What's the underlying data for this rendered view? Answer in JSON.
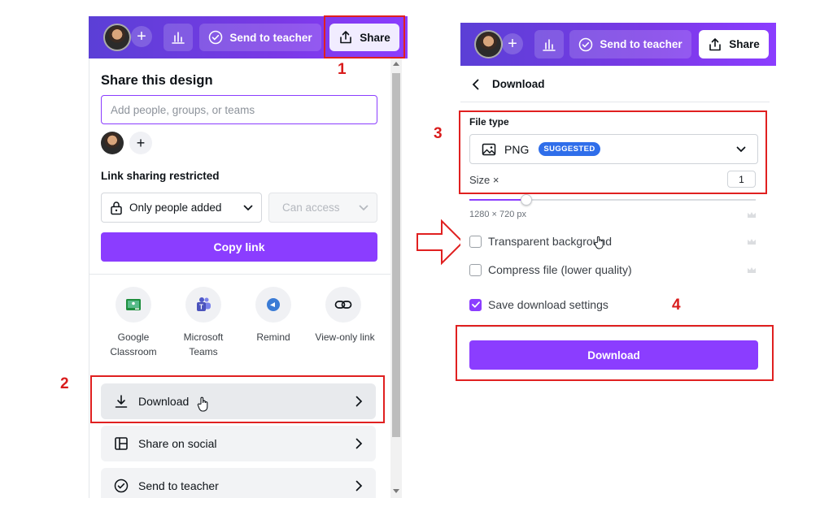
{
  "left": {
    "topbar": {
      "avatar_plus": "+",
      "send_to_teacher": "Send to teacher",
      "share": "Share"
    },
    "title": "Share this design",
    "people_input_placeholder": "Add people, groups, or teams",
    "add_plus": "+",
    "link_sharing_label": "Link sharing restricted",
    "access_select": "Only people added",
    "permission_select": "Can access",
    "copy_link": "Copy link",
    "apps": [
      {
        "label_line1": "Google",
        "label_line2": "Classroom",
        "icon": "google-classroom-icon",
        "color": "#1e8e3e"
      },
      {
        "label_line1": "Microsoft",
        "label_line2": "Teams",
        "icon": "microsoft-teams-icon",
        "color": "#5059c9"
      },
      {
        "label_line1": "Remind",
        "label_line2": "",
        "icon": "remind-icon",
        "color": "#3a7bd5"
      },
      {
        "label_line1": "View-only link",
        "label_line2": "",
        "icon": "link-icon",
        "color": "#0e1318"
      }
    ],
    "rows": [
      {
        "label": "Download",
        "icon": "download-icon"
      },
      {
        "label": "Share on social",
        "icon": "social-layout-icon"
      },
      {
        "label": "Send to teacher",
        "icon": "check-circle-icon"
      }
    ]
  },
  "right": {
    "topbar": {
      "avatar_plus": "+",
      "send_to_teacher": "Send to teacher",
      "share": "Share"
    },
    "back_title": "Download",
    "file_type_label": "File type",
    "file_type_value": "PNG",
    "suggested_badge": "SUGGESTED",
    "size_label": "Size ×",
    "size_value": "1",
    "size_fraction": 0.2,
    "dimensions": "1280 × 720 px",
    "options": [
      {
        "label": "Transparent background",
        "checked": false
      },
      {
        "label": "Compress file (lower quality)",
        "checked": false
      },
      {
        "label": "Save download settings",
        "checked": true
      }
    ],
    "download_button": "Download"
  },
  "annotations": {
    "step1": "1",
    "step2": "2",
    "step3": "3",
    "step4": "4"
  },
  "colors": {
    "brand_purple": "#8b3dff",
    "annotation_red": "#e02020",
    "badge_blue": "#2f6eea"
  }
}
